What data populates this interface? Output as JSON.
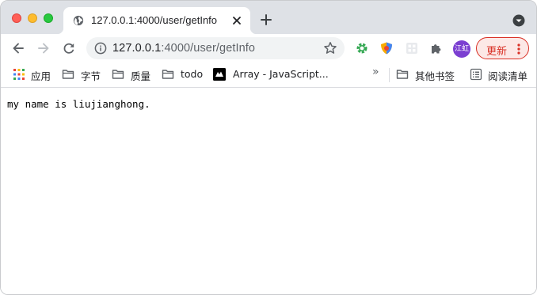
{
  "tab": {
    "title": "127.0.0.1:4000/user/getInfo"
  },
  "omnibox": {
    "host": "127.0.0.1",
    "path": ":4000/user/getInfo"
  },
  "profile": {
    "initials": "江虹"
  },
  "update_button": {
    "label": "更新"
  },
  "bookmarks": [
    {
      "label": "应用",
      "icon": "apps-grid-icon"
    },
    {
      "label": "字节",
      "icon": "folder-icon"
    },
    {
      "label": "质量",
      "icon": "folder-icon"
    },
    {
      "label": "todo",
      "icon": "folder-icon"
    },
    {
      "label": "Array - JavaScript...",
      "icon": "mdn-icon"
    }
  ],
  "bookmarks_overflow": "»",
  "other_bookmarks": {
    "label": "其他书签",
    "icon": "folder-icon"
  },
  "reading_list": {
    "label": "阅读清单",
    "icon": "reading-list-icon"
  },
  "page": {
    "body_text": "my name is liujianghong."
  },
  "colors": {
    "tabstrip": "#dee1e6",
    "accent_update": "#d93025",
    "avatar": "#7b3fd1"
  }
}
